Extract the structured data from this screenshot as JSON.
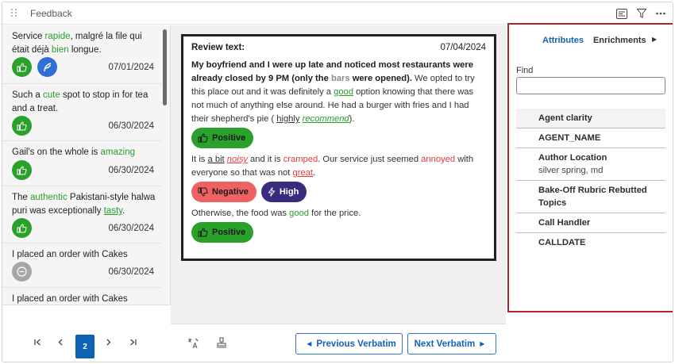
{
  "window": {
    "title": "Feedback"
  },
  "list": {
    "items": [
      {
        "text_before": "Service ",
        "kw1": "rapide",
        "text_mid": ", malgré la file qui était déjà ",
        "kw2": "bien",
        "text_after": " longue.",
        "date": "07/01/2024"
      },
      {
        "text_before": "Such a ",
        "kw1": "cute",
        "text_after": " spot to stop in for tea and a treat.",
        "date": "06/30/2024"
      },
      {
        "text_before": "Gail's on the whole is ",
        "kw1": "amazing",
        "text_after": "",
        "date": "06/30/2024"
      },
      {
        "text_before": "The ",
        "kw1": "authentic",
        "text_mid": " Pakistani-style halwa puri was exceptionally ",
        "kw2": "tasty",
        "text_after": ".",
        "date": "06/30/2024"
      },
      {
        "text_before": "I placed an order with Cakes",
        "date": "06/30/2024"
      },
      {
        "text_before": "I placed an order with Cakes",
        "date": ""
      }
    ]
  },
  "pagination": {
    "current": "2"
  },
  "verbatim": {
    "label": "Review text:",
    "date": "07/04/2024",
    "p1_b1": "My boyfriend and I were up late and noticed most restaurants were already closed by 9 PM (only the ",
    "p1_bars": "bars",
    "p1_b2": " were opened).",
    "p1_t1": " We opted to try this place out and it was definitely a ",
    "p1_good": "good",
    "p1_t2": " option knowing that there was not much of anything else around. He had a burger with fries and I had their shepherd's pie ( ",
    "p1_highly": "highly",
    "p1_recommend": "recommend",
    "p1_t3": ").",
    "p2_t1": "It is ",
    "p2_abit": "a bit",
    "p2_noisy": "noisy",
    "p2_t2": " and it is ",
    "p2_cramped": "cramped",
    "p2_t3": ". Our service just seemed ",
    "p2_annoyed": "annoyed",
    "p2_t4": " with everyone so that was not ",
    "p2_great": "great",
    "p2_t5": ".",
    "p3_t1": "Otherwise, the food was ",
    "p3_good": "good",
    "p3_t2": " for the price.",
    "pill_positive": "Positive",
    "pill_negative": "Negative",
    "pill_high": "High"
  },
  "footer": {
    "prev": "Previous Verbatim",
    "next": "Next Verbatim"
  },
  "side": {
    "tab_attributes": "Attributes",
    "tab_enrichments": "Enrichments",
    "find_label": "Find",
    "find_value": "",
    "attributes": [
      {
        "name": "Agent clarity",
        "value": ""
      },
      {
        "name": "AGENT_NAME",
        "value": ""
      },
      {
        "name": "Author Location",
        "value": "silver spring, md"
      },
      {
        "name": "Bake-Off Rubric Rebutted Topics",
        "value": ""
      },
      {
        "name": "Call Handler",
        "value": ""
      },
      {
        "name": "CALLDATE",
        "value": ""
      }
    ]
  },
  "colors": {
    "accent": "#1560b8",
    "positive": "#2aa12a",
    "negative": "#f06262",
    "high": "#3a2a80",
    "highlight_border": "#b3242d"
  }
}
